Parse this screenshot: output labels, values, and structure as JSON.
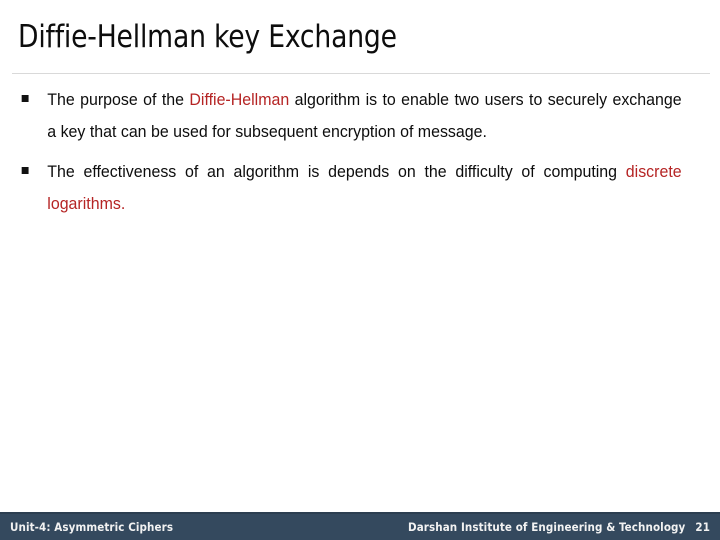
{
  "slide": {
    "title": "Diffie-Hellman key Exchange",
    "bullet_glyph": "square-bullet",
    "accent_red": "#B52424",
    "text_color": "#0D0D0D",
    "footer_bg": "#34495E",
    "divider_color": "#D9D9D9"
  },
  "bullets": [
    {
      "id": "bullet-1",
      "lines": [
        {
          "justified": true,
          "runs": [
            {
              "text": "The purpose of the ",
              "color": "black"
            },
            {
              "text": "Diffie-Hellman",
              "color": "red"
            },
            {
              "text": " algorithm is to enable two users",
              "color": "black"
            }
          ]
        },
        {
          "justified": true,
          "runs": [
            {
              "text": "to securely exchange a key that can be used for subsequent",
              "color": "black"
            }
          ]
        },
        {
          "justified": false,
          "runs": [
            {
              "text": "encryption of message.",
              "color": "black"
            }
          ]
        }
      ],
      "line_1_prefix": "The purpose of the ",
      "line_1_red": "Diffie-Hellman",
      "line_1_suffix": " algorithm is to enable two users",
      "line_2": "to securely exchange a key that can be used for subsequent",
      "line_3": "encryption of message."
    },
    {
      "id": "bullet-2",
      "line_1": "The effectiveness of an algorithm is depends on the difficulty of",
      "line_2_prefix": "computing ",
      "line_2_red": "discrete logarithms."
    }
  ],
  "footer": {
    "left_text": "Unit-4: Asymmetric Ciphers",
    "organization": "Darshan Institute of Engineering & Technology",
    "page_number": "21"
  }
}
